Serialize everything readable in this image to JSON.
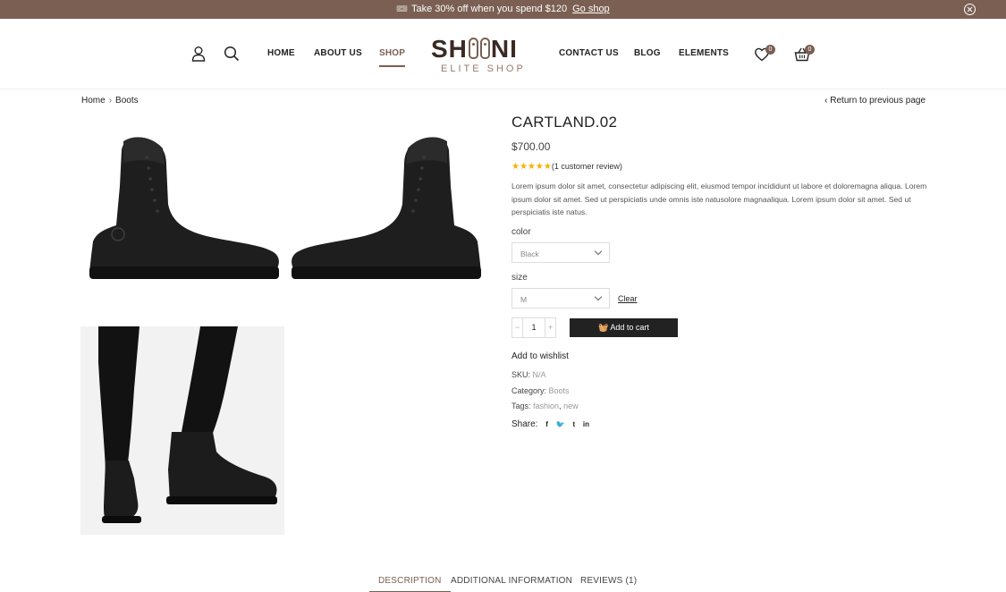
{
  "announcement": {
    "message": "Take 30% off when you spend $120",
    "link_label": "Go shop"
  },
  "header": {
    "nav_left": [
      "HOME",
      "ABOUT US",
      "SHOP"
    ],
    "nav_right": [
      "CONTACT US",
      "BLOG",
      "ELEMENTS"
    ],
    "active_nav": "SHOP",
    "logo": {
      "word_start": "SH",
      "word_end": "NI",
      "subtitle": "ELITE SHOP"
    },
    "wishlist_count": "0",
    "cart_count": "0"
  },
  "breadcrumb": {
    "home": "Home",
    "current": "Boots",
    "back_label": "Return to previous page"
  },
  "product": {
    "title": "CARTLAND.02",
    "price": "$700.00",
    "stars": "★★★★★",
    "review_text": "(1 customer review)",
    "description": "Lorem ipsum dolor sit amet, consectetur adipiscing elit, eiusmod tempor incididunt ut labore et doloremagna aliqua. Lorem ipsum dolor sit amet. Sed ut perspiciatis unde omnis iste natusolore magnaaliqua. Lorem ipsum dolor sit amet. Sed ut perspiciatis iste natus.",
    "color_label": "color",
    "color_value": "Black",
    "size_label": "size",
    "size_value": "M",
    "clear_label": "Clear",
    "qty_minus": "−",
    "qty_value": "1",
    "qty_plus": "+",
    "add_to_cart": "Add to cart",
    "add_to_wishlist": "Add to wishlist",
    "sku_label": "SKU:",
    "sku_value": "N/A",
    "category_label": "Category:",
    "category_value": "Boots",
    "tags_label": "Tags:",
    "tag1": "fashion",
    "tag_sep": ",",
    "tag2": "new",
    "share_label": "Share:",
    "share_icons": [
      "f",
      "t",
      "t",
      "in"
    ]
  },
  "tabs": [
    "DESCRIPTION",
    "ADDITIONAL INFORMATION",
    "REVIEWS (1)"
  ],
  "colors": {
    "brand": "#7a5f52",
    "dark": "#222222",
    "star": "#f0b400"
  }
}
